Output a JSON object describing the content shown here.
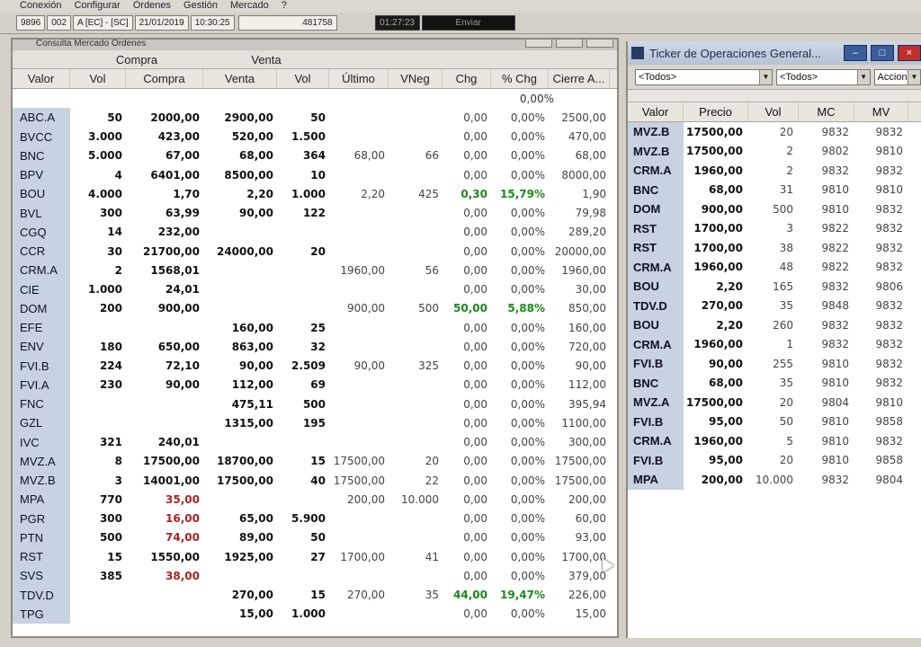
{
  "menu": [
    "Conexión",
    "Configurar",
    "Órdenes",
    "Gestión",
    "Mercado",
    "?"
  ],
  "status": {
    "user": "9896",
    "code": "002",
    "market": "A [EC] - [SC]",
    "date": "21/01/2019",
    "time": "10:30:25",
    "number": "481758",
    "clock": "01:27:23",
    "send_button": "Enviar"
  },
  "left_window": {
    "title": "Consulta Mercado Órdenes",
    "group_compra": "Compra",
    "group_venta": "Venta",
    "columns": [
      "Valor",
      "Vol",
      "Compra",
      "Venta",
      "Vol",
      "Último",
      "VNeg",
      "Chg",
      "% Chg",
      "Cierre A..."
    ],
    "first_row_pct": "0,00%",
    "rows": [
      {
        "sym": "ABC.A",
        "vc": "50",
        "compra": "2000,00",
        "venta": "2900,00",
        "vv": "50",
        "ult": "",
        "vneg": "",
        "chg": "0,00",
        "pct": "0,00%",
        "cierre": "2500,00"
      },
      {
        "sym": "BVCC",
        "vc": "3.000",
        "compra": "423,00",
        "venta": "520,00",
        "vv": "1.500",
        "ult": "",
        "vneg": "",
        "chg": "0,00",
        "pct": "0,00%",
        "cierre": "470,00"
      },
      {
        "sym": "BNC",
        "vc": "5.000",
        "compra": "67,00",
        "venta": "68,00",
        "vv": "364",
        "ult": "68,00",
        "vneg": "66",
        "chg": "0,00",
        "pct": "0,00%",
        "cierre": "68,00"
      },
      {
        "sym": "BPV",
        "vc": "4",
        "compra": "6401,00",
        "venta": "8500,00",
        "vv": "10",
        "ult": "",
        "vneg": "",
        "chg": "0,00",
        "pct": "0,00%",
        "cierre": "8000,00"
      },
      {
        "sym": "BOU",
        "vc": "4.000",
        "compra": "1,70",
        "venta": "2,20",
        "vv": "1.000",
        "ult": "2,20",
        "vneg": "425",
        "chg": "0,30",
        "pct": "15,79%",
        "cierre": "1,90",
        "up": true
      },
      {
        "sym": "BVL",
        "vc": "300",
        "compra": "63,99",
        "venta": "90,00",
        "vv": "122",
        "ult": "",
        "vneg": "",
        "chg": "0,00",
        "pct": "0,00%",
        "cierre": "79,98"
      },
      {
        "sym": "CGQ",
        "vc": "14",
        "compra": "232,00",
        "venta": "",
        "vv": "",
        "ult": "",
        "vneg": "",
        "chg": "0,00",
        "pct": "0,00%",
        "cierre": "289,20"
      },
      {
        "sym": "CCR",
        "vc": "30",
        "compra": "21700,00",
        "venta": "24000,00",
        "vv": "20",
        "ult": "",
        "vneg": "",
        "chg": "0,00",
        "pct": "0,00%",
        "cierre": "20000,00"
      },
      {
        "sym": "CRM.A",
        "vc": "2",
        "compra": "1568,01",
        "venta": "",
        "vv": "",
        "ult": "1960,00",
        "vneg": "56",
        "chg": "0,00",
        "pct": "0,00%",
        "cierre": "1960,00"
      },
      {
        "sym": "CIE",
        "vc": "1.000",
        "compra": "24,01",
        "venta": "",
        "vv": "",
        "ult": "",
        "vneg": "",
        "chg": "0,00",
        "pct": "0,00%",
        "cierre": "30,00"
      },
      {
        "sym": "DOM",
        "vc": "200",
        "compra": "900,00",
        "venta": "",
        "vv": "",
        "ult": "900,00",
        "vneg": "500",
        "chg": "50,00",
        "pct": "5,88%",
        "cierre": "850,00",
        "up": true
      },
      {
        "sym": "EFE",
        "vc": "",
        "compra": "",
        "venta": "160,00",
        "vv": "25",
        "ult": "",
        "vneg": "",
        "chg": "0,00",
        "pct": "0,00%",
        "cierre": "160,00"
      },
      {
        "sym": "ENV",
        "vc": "180",
        "compra": "650,00",
        "venta": "863,00",
        "vv": "32",
        "ult": "",
        "vneg": "",
        "chg": "0,00",
        "pct": "0,00%",
        "cierre": "720,00"
      },
      {
        "sym": "FVI.B",
        "vc": "224",
        "compra": "72,10",
        "venta": "90,00",
        "vv": "2.509",
        "ult": "90,00",
        "vneg": "325",
        "chg": "0,00",
        "pct": "0,00%",
        "cierre": "90,00"
      },
      {
        "sym": "FVI.A",
        "vc": "230",
        "compra": "90,00",
        "venta": "112,00",
        "vv": "69",
        "ult": "",
        "vneg": "",
        "chg": "0,00",
        "pct": "0,00%",
        "cierre": "112,00"
      },
      {
        "sym": "FNC",
        "vc": "",
        "compra": "",
        "venta": "475,11",
        "vv": "500",
        "ult": "",
        "vneg": "",
        "chg": "0,00",
        "pct": "0,00%",
        "cierre": "395,94"
      },
      {
        "sym": "GZL",
        "vc": "",
        "compra": "",
        "venta": "1315,00",
        "vv": "195",
        "ult": "",
        "vneg": "",
        "chg": "0,00",
        "pct": "0,00%",
        "cierre": "1100,00"
      },
      {
        "sym": "IVC",
        "vc": "321",
        "compra": "240,01",
        "venta": "",
        "vv": "",
        "ult": "",
        "vneg": "",
        "chg": "0,00",
        "pct": "0,00%",
        "cierre": "300,00"
      },
      {
        "sym": "MVZ.A",
        "vc": "8",
        "compra": "17500,00",
        "venta": "18700,00",
        "vv": "15",
        "ult": "17500,00",
        "vneg": "20",
        "chg": "0,00",
        "pct": "0,00%",
        "cierre": "17500,00"
      },
      {
        "sym": "MVZ.B",
        "vc": "3",
        "compra": "14001,00",
        "venta": "17500,00",
        "vv": "40",
        "ult": "17500,00",
        "vneg": "22",
        "chg": "0,00",
        "pct": "0,00%",
        "cierre": "17500,00"
      },
      {
        "sym": "MPA",
        "vc": "770",
        "compra": "35,00",
        "venta": "",
        "vv": "",
        "ult": "200,00",
        "vneg": "10.000",
        "chg": "0,00",
        "pct": "0,00%",
        "cierre": "200,00",
        "red": true
      },
      {
        "sym": "PGR",
        "vc": "300",
        "compra": "16,00",
        "venta": "65,00",
        "vv": "5.900",
        "ult": "",
        "vneg": "",
        "chg": "0,00",
        "pct": "0,00%",
        "cierre": "60,00",
        "red": true
      },
      {
        "sym": "PTN",
        "vc": "500",
        "compra": "74,00",
        "venta": "89,00",
        "vv": "50",
        "ult": "",
        "vneg": "",
        "chg": "0,00",
        "pct": "0,00%",
        "cierre": "93,00",
        "red": true
      },
      {
        "sym": "RST",
        "vc": "15",
        "compra": "1550,00",
        "venta": "1925,00",
        "vv": "27",
        "ult": "1700,00",
        "vneg": "41",
        "chg": "0,00",
        "pct": "0,00%",
        "cierre": "1700,00"
      },
      {
        "sym": "SVS",
        "vc": "385",
        "compra": "38,00",
        "venta": "",
        "vv": "",
        "ult": "",
        "vneg": "",
        "chg": "0,00",
        "pct": "0,00%",
        "cierre": "379,00",
        "red": true
      },
      {
        "sym": "TDV.D",
        "vc": "",
        "compra": "",
        "venta": "270,00",
        "vv": "15",
        "ult": "270,00",
        "vneg": "35",
        "chg": "44,00",
        "pct": "19,47%",
        "cierre": "226,00",
        "up": true
      },
      {
        "sym": "TPG",
        "vc": "",
        "compra": "",
        "venta": "15,00",
        "vv": "1.000",
        "ult": "",
        "vneg": "",
        "chg": "0,00",
        "pct": "0,00%",
        "cierre": "15,00"
      }
    ]
  },
  "right_window": {
    "title": "Ticker de Operaciones General...",
    "filter1": "<Todos>",
    "filter2": "<Todos>",
    "filter3": "Accione",
    "columns": [
      "Valor",
      "Precio",
      "Vol",
      "MC",
      "MV"
    ],
    "rows": [
      {
        "sym": "MVZ.B",
        "precio": "17500,00",
        "vol": "20",
        "mc": "9832",
        "mv": "9832"
      },
      {
        "sym": "MVZ.B",
        "precio": "17500,00",
        "vol": "2",
        "mc": "9802",
        "mv": "9810"
      },
      {
        "sym": "CRM.A",
        "precio": "1960,00",
        "vol": "2",
        "mc": "9832",
        "mv": "9832"
      },
      {
        "sym": "BNC",
        "precio": "68,00",
        "vol": "31",
        "mc": "9810",
        "mv": "9810"
      },
      {
        "sym": "DOM",
        "precio": "900,00",
        "vol": "500",
        "mc": "9810",
        "mv": "9832"
      },
      {
        "sym": "RST",
        "precio": "1700,00",
        "vol": "3",
        "mc": "9822",
        "mv": "9832"
      },
      {
        "sym": "RST",
        "precio": "1700,00",
        "vol": "38",
        "mc": "9822",
        "mv": "9832"
      },
      {
        "sym": "CRM.A",
        "precio": "1960,00",
        "vol": "48",
        "mc": "9822",
        "mv": "9832"
      },
      {
        "sym": "BOU",
        "precio": "2,20",
        "vol": "165",
        "mc": "9832",
        "mv": "9806"
      },
      {
        "sym": "TDV.D",
        "precio": "270,00",
        "vol": "35",
        "mc": "9848",
        "mv": "9832"
      },
      {
        "sym": "BOU",
        "precio": "2,20",
        "vol": "260",
        "mc": "9832",
        "mv": "9832"
      },
      {
        "sym": "CRM.A",
        "precio": "1960,00",
        "vol": "1",
        "mc": "9832",
        "mv": "9832"
      },
      {
        "sym": "FVI.B",
        "precio": "90,00",
        "vol": "255",
        "mc": "9810",
        "mv": "9832"
      },
      {
        "sym": "BNC",
        "precio": "68,00",
        "vol": "35",
        "mc": "9810",
        "mv": "9832"
      },
      {
        "sym": "MVZ.A",
        "precio": "17500,00",
        "vol": "20",
        "mc": "9804",
        "mv": "9810"
      },
      {
        "sym": "FVI.B",
        "precio": "95,00",
        "vol": "50",
        "mc": "9810",
        "mv": "9858"
      },
      {
        "sym": "CRM.A",
        "precio": "1960,00",
        "vol": "5",
        "mc": "9810",
        "mv": "9832"
      },
      {
        "sym": "FVI.B",
        "precio": "95,00",
        "vol": "20",
        "mc": "9810",
        "mv": "9858"
      },
      {
        "sym": "MPA",
        "precio": "200,00",
        "vol": "10.000",
        "mc": "9832",
        "mv": "9804"
      }
    ]
  }
}
